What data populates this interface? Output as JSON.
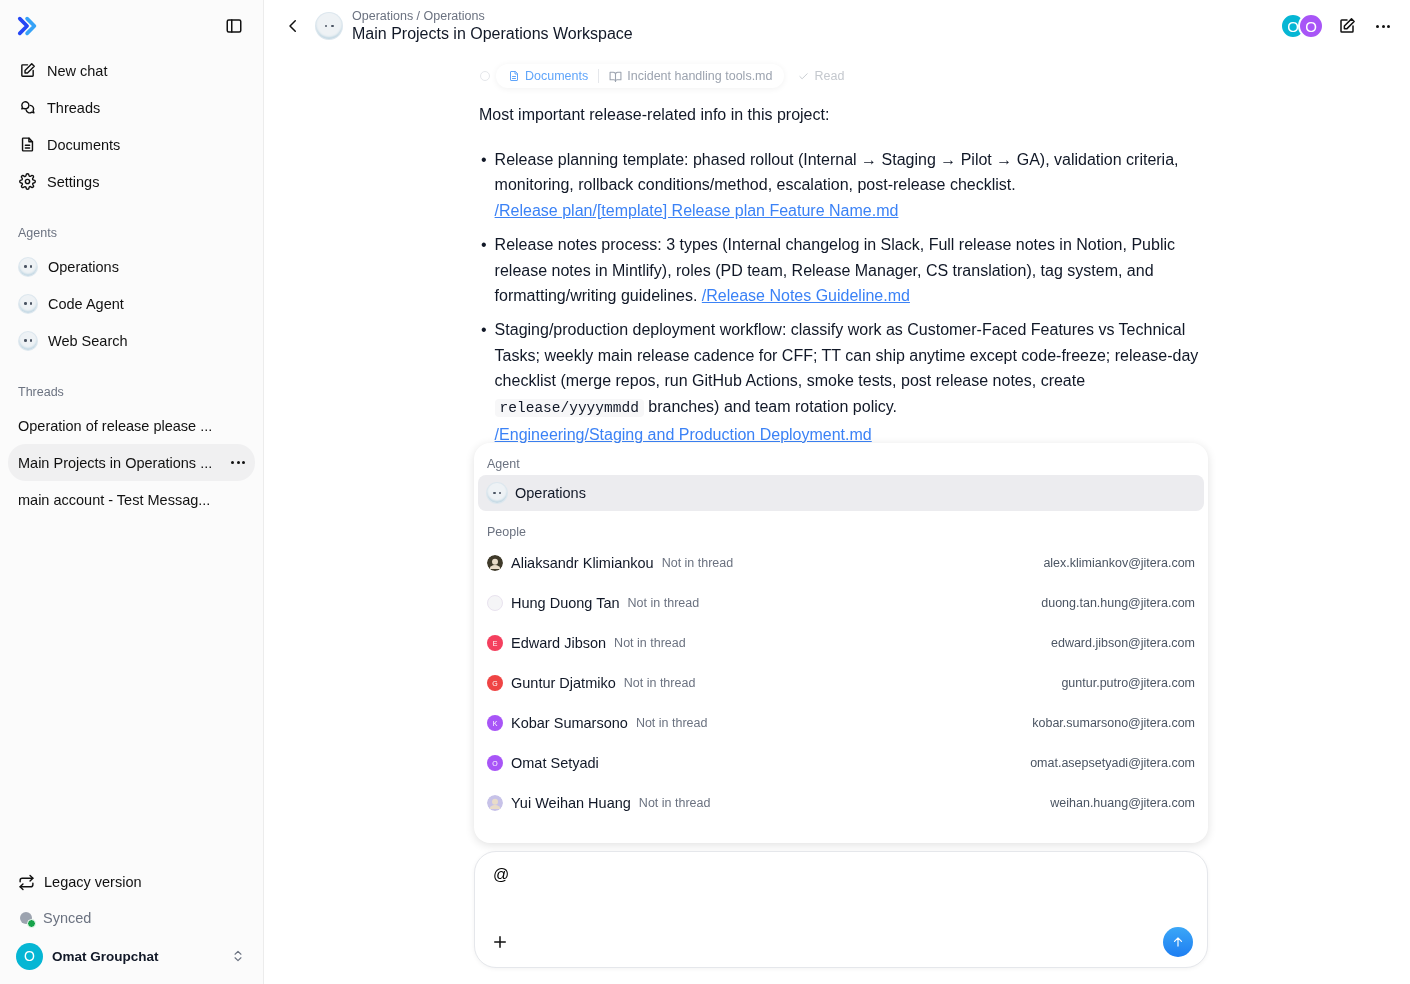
{
  "sidebar": {
    "nav": [
      {
        "label": "New chat"
      },
      {
        "label": "Threads"
      },
      {
        "label": "Documents"
      },
      {
        "label": "Settings"
      }
    ],
    "agents_heading": "Agents",
    "agents": [
      {
        "label": "Operations"
      },
      {
        "label": "Code Agent"
      },
      {
        "label": "Web Search"
      }
    ],
    "threads_heading": "Threads",
    "threads": [
      {
        "label": "Operation of release please ...",
        "selected": false
      },
      {
        "label": "Main Projects in Operations ...",
        "selected": true
      },
      {
        "label": "main account - Test Messag...",
        "selected": false
      }
    ],
    "legacy": "Legacy version",
    "sync_status": "Synced",
    "user": {
      "initial": "O",
      "name": "Omat Groupchat"
    }
  },
  "header": {
    "breadcrumb": "Operations / Operations",
    "title": "Main Projects in Operations Workspace",
    "participants": [
      {
        "initial": "O",
        "color": "#06b6d4"
      },
      {
        "initial": "O",
        "color": "#a855f7"
      }
    ]
  },
  "tool_step": {
    "source": "Documents",
    "file": "Incident handling tools.md",
    "status": "Read"
  },
  "message": {
    "intro": "Most important release-related info in this project:",
    "bullets": [
      {
        "marker": "•",
        "parts": [
          {
            "kind": "text",
            "text": "Release planning template: phased rollout (Internal → Staging → Pilot → GA), validation criteria, monitoring, rollback conditions/method, escalation, post-release checklist. "
          },
          {
            "kind": "link",
            "text": "/Release plan/[template] Release plan Feature Name.md"
          }
        ]
      },
      {
        "marker": "•",
        "parts": [
          {
            "kind": "text",
            "text": "Release notes process: 3 types (Internal changelog in Slack, Full release notes in Notion, Public release notes in Mintlify), roles (PD team, Release Manager, CS translation), tag system, and formatting/writing guidelines. "
          },
          {
            "kind": "link",
            "text": "/Release Notes Guideline.md"
          }
        ]
      },
      {
        "marker": "•",
        "parts": [
          {
            "kind": "text",
            "text": "Staging/production deployment workflow: classify work as Customer-Faced Features vs Technical Tasks; weekly main release cadence for CFF; TT can ship anytime except code-freeze; release-day checklist (merge repos, run GitHub Actions, smoke tests, post release notes, create "
          },
          {
            "kind": "code",
            "text": "release/yyyymmdd"
          },
          {
            "kind": "text",
            "text": " branches) and team rotation policy. "
          },
          {
            "kind": "link",
            "text": "/Engineering/Staging and Production Deployment.md"
          }
        ]
      }
    ]
  },
  "mention_popup": {
    "agent_heading": "Agent",
    "agents": [
      {
        "name": "Operations",
        "selected": true
      }
    ],
    "people_heading": "People",
    "people": [
      {
        "name": "Aliaksandr Klimiankou",
        "status": "Not in thread",
        "email": "alex.klimiankov@jitera.com",
        "kind": "photo",
        "color": "#3f3a2a"
      },
      {
        "name": "Hung Duong Tan",
        "status": "Not in thread",
        "email": "duong.tan.hung@jitera.com",
        "kind": "blank"
      },
      {
        "name": "Edward Jibson",
        "status": "Not in thread",
        "email": "edward.jibson@jitera.com",
        "kind": "initial",
        "initial": "E",
        "color": "#f43f5e"
      },
      {
        "name": "Guntur Djatmiko",
        "status": "Not in thread",
        "email": "guntur.putro@jitera.com",
        "kind": "initial",
        "initial": "G",
        "color": "#ef4444"
      },
      {
        "name": "Kobar Sumarsono",
        "status": "Not in thread",
        "email": "kobar.sumarsono@jitera.com",
        "kind": "initial",
        "initial": "K",
        "color": "#a855f7"
      },
      {
        "name": "Omat Setyadi",
        "email": "omat.asepsetyadi@jitera.com",
        "kind": "initial",
        "initial": "O",
        "color": "#a855f7"
      },
      {
        "name": "Yui Weihan Huang",
        "status": "Not in thread",
        "email": "weihan.huang@jitera.com",
        "kind": "photo",
        "color": "#c7c2e8"
      }
    ]
  },
  "composer": {
    "value": "@"
  }
}
